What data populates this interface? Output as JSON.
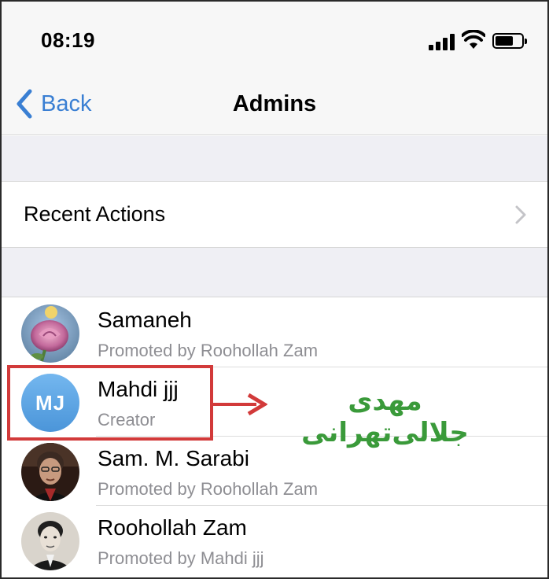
{
  "status_bar": {
    "time": "08:19",
    "battery_level": 0.7
  },
  "nav": {
    "back_label": "Back",
    "title": "Admins"
  },
  "recent_actions": {
    "label": "Recent Actions"
  },
  "admins": [
    {
      "name": "Samaneh",
      "subtitle": "Promoted by Roohollah Zam",
      "avatar": "rose-photo"
    },
    {
      "name": "Mahdi jjj",
      "subtitle": "Creator",
      "avatar_initials": "MJ"
    },
    {
      "name": "Sam. M. Sarabi",
      "subtitle": "Promoted by Roohollah Zam",
      "avatar": "man-photo"
    },
    {
      "name": "Roohollah Zam",
      "subtitle": "Promoted by Mahdi jjj",
      "avatar": "man-photo-bw"
    }
  ],
  "annotation": {
    "caption": "مهدی جلالی‌تهرانی",
    "box_color": "#d23a3a",
    "caption_color": "#3a9a3a"
  },
  "colors": {
    "accent": "#3a7fd3",
    "secondary_text": "#8e8e93",
    "group_background": "#efeff4"
  }
}
